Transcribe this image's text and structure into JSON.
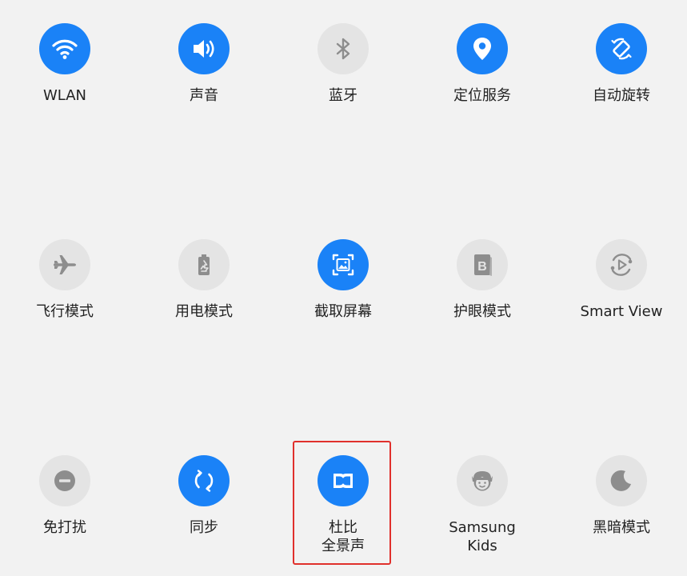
{
  "quick_settings": {
    "row1": [
      {
        "label": "WLAN",
        "icon": "wifi-icon",
        "state": "on"
      },
      {
        "label": "声音",
        "icon": "volume-icon",
        "state": "on"
      },
      {
        "label": "蓝牙",
        "icon": "bluetooth-icon",
        "state": "off"
      },
      {
        "label": "定位服务",
        "icon": "location-icon",
        "state": "on"
      },
      {
        "label": "自动旋转",
        "icon": "auto-rotate-icon",
        "state": "on"
      }
    ],
    "row2": [
      {
        "label": "飞行模式",
        "icon": "airplane-icon",
        "state": "off"
      },
      {
        "label": "用电模式",
        "icon": "battery-saver-icon",
        "state": "off"
      },
      {
        "label": "截取屏幕",
        "icon": "screenshot-icon",
        "state": "on"
      },
      {
        "label": "护眼模式",
        "icon": "eye-comfort-icon",
        "state": "off"
      },
      {
        "label": "Smart View",
        "icon": "smart-view-icon",
        "state": "off"
      }
    ],
    "row3": [
      {
        "label": "免打扰",
        "icon": "do-not-disturb-icon",
        "state": "off"
      },
      {
        "label": "同步",
        "icon": "sync-icon",
        "state": "on"
      },
      {
        "label_line1": "杜比",
        "label_line2": "全景声",
        "icon": "dolby-atmos-icon",
        "state": "on"
      },
      {
        "label_line1": "Samsung",
        "label_line2": "Kids",
        "icon": "samsung-kids-icon",
        "state": "off"
      },
      {
        "label": "黑暗模式",
        "icon": "dark-mode-icon",
        "state": "off"
      }
    ]
  },
  "colors": {
    "active": "#1a82f7",
    "inactive": "#e4e4e4",
    "inactive_glyph": "#8d8d8d",
    "background": "#f2f2f2",
    "highlight_border": "#e0302c"
  }
}
